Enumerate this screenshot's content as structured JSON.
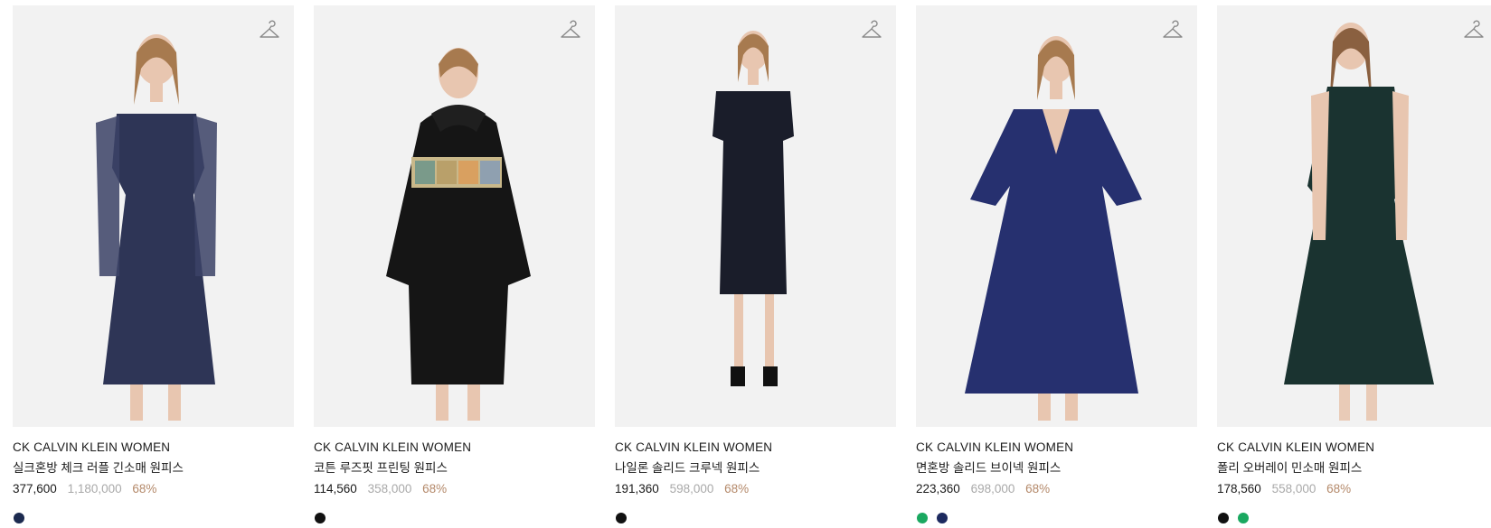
{
  "products": [
    {
      "brand": "CK CALVIN KLEIN WOMEN",
      "name": "실크혼방 체크 러플 긴소매 원피스",
      "price": "377,600",
      "original_price": "1,180,000",
      "discount": "68%",
      "swatches": [
        "#1c2a4f"
      ],
      "dress_color": "#2e3556"
    },
    {
      "brand": "CK CALVIN KLEIN WOMEN",
      "name": "코튼 루즈핏 프린팅 원피스",
      "price": "114,560",
      "original_price": "358,000",
      "discount": "68%",
      "swatches": [
        "#111111"
      ],
      "dress_color": "#151515"
    },
    {
      "brand": "CK CALVIN KLEIN WOMEN",
      "name": "나일론 솔리드 크루넥 원피스",
      "price": "191,360",
      "original_price": "598,000",
      "discount": "68%",
      "swatches": [
        "#111111"
      ],
      "dress_color": "#1a1d2a"
    },
    {
      "brand": "CK CALVIN KLEIN WOMEN",
      "name": "면혼방 솔리드 브이넥 원피스",
      "price": "223,360",
      "original_price": "698,000",
      "discount": "68%",
      "swatches": [
        "#1aa860",
        "#1c2a5f"
      ],
      "dress_color": "#26306f"
    },
    {
      "brand": "CK CALVIN KLEIN WOMEN",
      "name": "폴리 오버레이 민소매 원피스",
      "price": "178,560",
      "original_price": "558,000",
      "discount": "68%",
      "swatches": [
        "#111111",
        "#1aa860"
      ],
      "dress_color": "#1a3330"
    }
  ],
  "icons": {
    "wishlist": "hanger-icon"
  },
  "colors": {
    "discount": "#b4896a",
    "original_price": "#a9a9a9",
    "image_bg": "#f2f2f2"
  }
}
